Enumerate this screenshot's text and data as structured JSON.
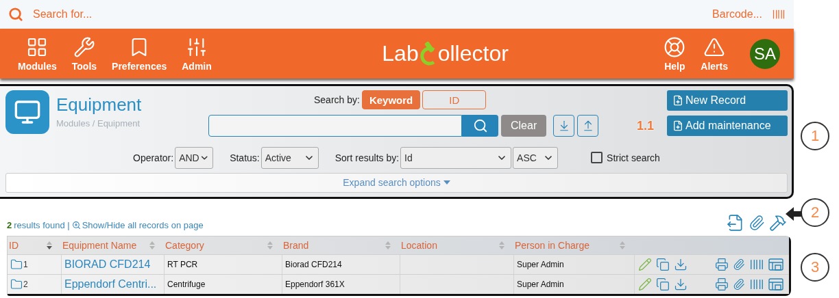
{
  "top_bar": {
    "search": {
      "placeholder": "Search for..."
    },
    "barcode": {
      "placeholder": "Barcode..."
    }
  },
  "nav": {
    "items": [
      {
        "label": "Modules",
        "kind": "grid"
      },
      {
        "label": "Tools",
        "kind": "wrench"
      },
      {
        "label": "Preferences",
        "kind": "bookmark"
      },
      {
        "label": "Admin",
        "kind": "sliders"
      }
    ],
    "logo": {
      "before": "Lab",
      "after": "ollector"
    },
    "right_items": [
      {
        "label": "Help",
        "kind": "lifebuoy"
      },
      {
        "label": "Alerts",
        "kind": "alert"
      }
    ],
    "avatar": "SA"
  },
  "module": {
    "title": "Equipment",
    "breadcrumb": "Modules / Equipment"
  },
  "search_by": {
    "label": "Search by:",
    "options": [
      {
        "label": "Keyword",
        "selected": true
      },
      {
        "label": "ID",
        "selected": false
      }
    ]
  },
  "search": {
    "clear": "Clear"
  },
  "filters": [
    {
      "label": "Operator:",
      "value": "AND"
    },
    {
      "label": "Status:",
      "value": "Active"
    },
    {
      "label": "Sort results by:",
      "value": "Id"
    },
    {
      "value": "ASC"
    }
  ],
  "strict_search": {
    "label": "Strict search",
    "checked": false
  },
  "actions": [
    "New Record",
    "Add maintenance"
  ],
  "expand": "Expand search options",
  "results": {
    "count": "2",
    "text": "results found |",
    "toggle": "Show/Hide all records on page"
  },
  "table": {
    "columns": [
      {
        "label": "ID",
        "sorted": true
      },
      {
        "label": "Equipment Name",
        "sorted": false
      },
      {
        "label": "Category",
        "sorted": false
      },
      {
        "label": "Brand",
        "sorted": false
      },
      {
        "label": "Location",
        "sorted": false
      },
      {
        "label": "Person in Charge",
        "sorted": false
      }
    ],
    "rows": [
      {
        "id": "1",
        "name": "BIORAD CFD214",
        "category": "RT PCR",
        "brand": "Biorad CFD214",
        "person": "Super Admin"
      },
      {
        "id": "2",
        "name": "Eppendorf Centri...",
        "category": "Centrifuge",
        "brand": "Eppendorf 361X",
        "person": "Super Admin"
      }
    ]
  },
  "annotations": {
    "sub_label": "1.1",
    "callouts": [
      "1",
      "2",
      "3"
    ]
  }
}
